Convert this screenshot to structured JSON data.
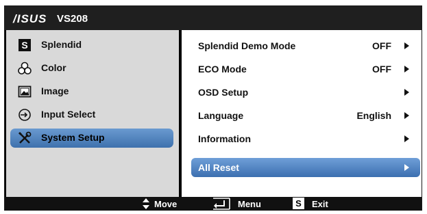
{
  "header": {
    "brand": "/ISUS",
    "model": "VS208"
  },
  "left_menu": {
    "items": [
      {
        "label": "Splendid",
        "icon": "splendid-icon",
        "selected": false
      },
      {
        "label": "Color",
        "icon": "color-icon",
        "selected": false
      },
      {
        "label": "Image",
        "icon": "image-icon",
        "selected": false
      },
      {
        "label": "Input Select",
        "icon": "input-select-icon",
        "selected": false
      },
      {
        "label": "System Setup",
        "icon": "wrench-screwdriver-icon",
        "selected": true
      }
    ]
  },
  "right_menu": {
    "items": [
      {
        "label": "Splendid Demo Mode",
        "value": "OFF"
      },
      {
        "label": "ECO Mode",
        "value": "OFF"
      },
      {
        "label": "OSD Setup",
        "value": ""
      },
      {
        "label": "Language",
        "value": "English"
      },
      {
        "label": "Information",
        "value": ""
      },
      {
        "label": "All Reset",
        "value": "",
        "selected": true
      }
    ]
  },
  "footer": {
    "move": "Move",
    "menu": "Menu",
    "exit": "Exit",
    "exit_key": "S"
  },
  "colors": {
    "selection": "#4a7fbf",
    "left_bg": "#d9d9d9",
    "bar_bg": "#1f1f1f"
  }
}
